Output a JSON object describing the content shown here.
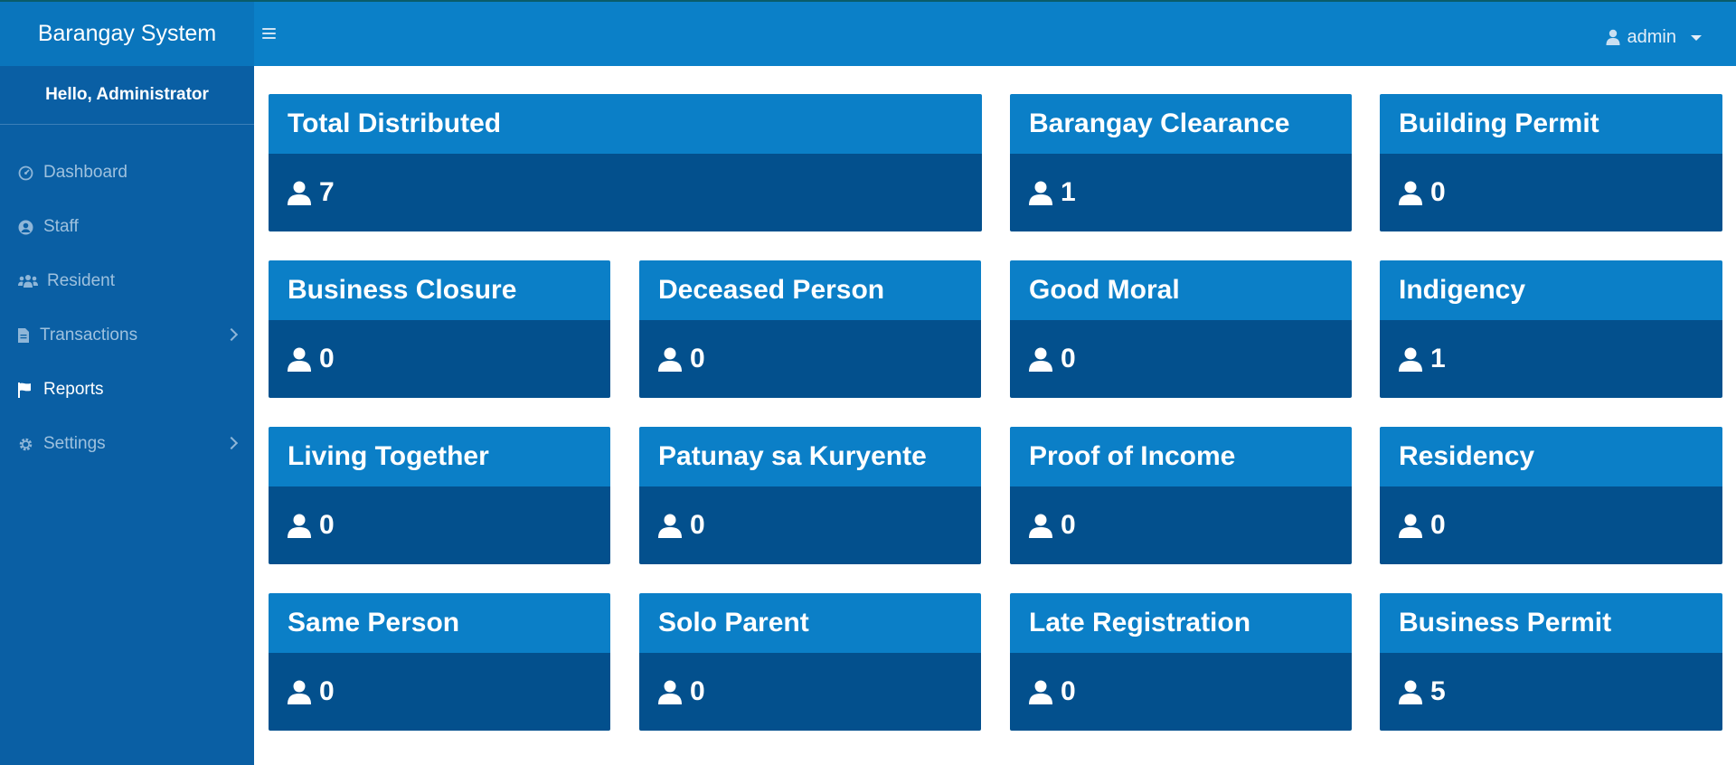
{
  "header": {
    "brand": "Barangay System",
    "user": "admin"
  },
  "sidebar": {
    "greeting": "Hello, Administrator",
    "items": [
      {
        "label": "Dashboard",
        "icon": "dashboard-icon"
      },
      {
        "label": "Staff",
        "icon": "user-circle-icon"
      },
      {
        "label": "Resident",
        "icon": "users-icon"
      },
      {
        "label": "Transactions",
        "icon": "file-icon"
      },
      {
        "label": "Reports",
        "icon": "flag-icon"
      },
      {
        "label": "Settings",
        "icon": "gear-icon"
      }
    ]
  },
  "cards": [
    {
      "title": "Total Distributed",
      "count": "7"
    },
    {
      "title": "Barangay Clearance",
      "count": "1"
    },
    {
      "title": "Building Permit",
      "count": "0"
    },
    {
      "title": "Business Closure",
      "count": "0"
    },
    {
      "title": "Deceased Person",
      "count": "0"
    },
    {
      "title": "Good Moral",
      "count": "0"
    },
    {
      "title": "Indigency",
      "count": "1"
    },
    {
      "title": "Living Together",
      "count": "0"
    },
    {
      "title": "Patunay sa Kuryente",
      "count": "0"
    },
    {
      "title": "Proof of Income",
      "count": "0"
    },
    {
      "title": "Residency",
      "count": "0"
    },
    {
      "title": "Same Person",
      "count": "0"
    },
    {
      "title": "Solo Parent",
      "count": "0"
    },
    {
      "title": "Late Registration",
      "count": "0"
    },
    {
      "title": "Business Permit",
      "count": "5"
    }
  ],
  "colors": {
    "topbar": "#0b80c8",
    "sidebar": "#0a5fa4",
    "card_header": "#0b7fc7",
    "card_body": "#03508d"
  }
}
